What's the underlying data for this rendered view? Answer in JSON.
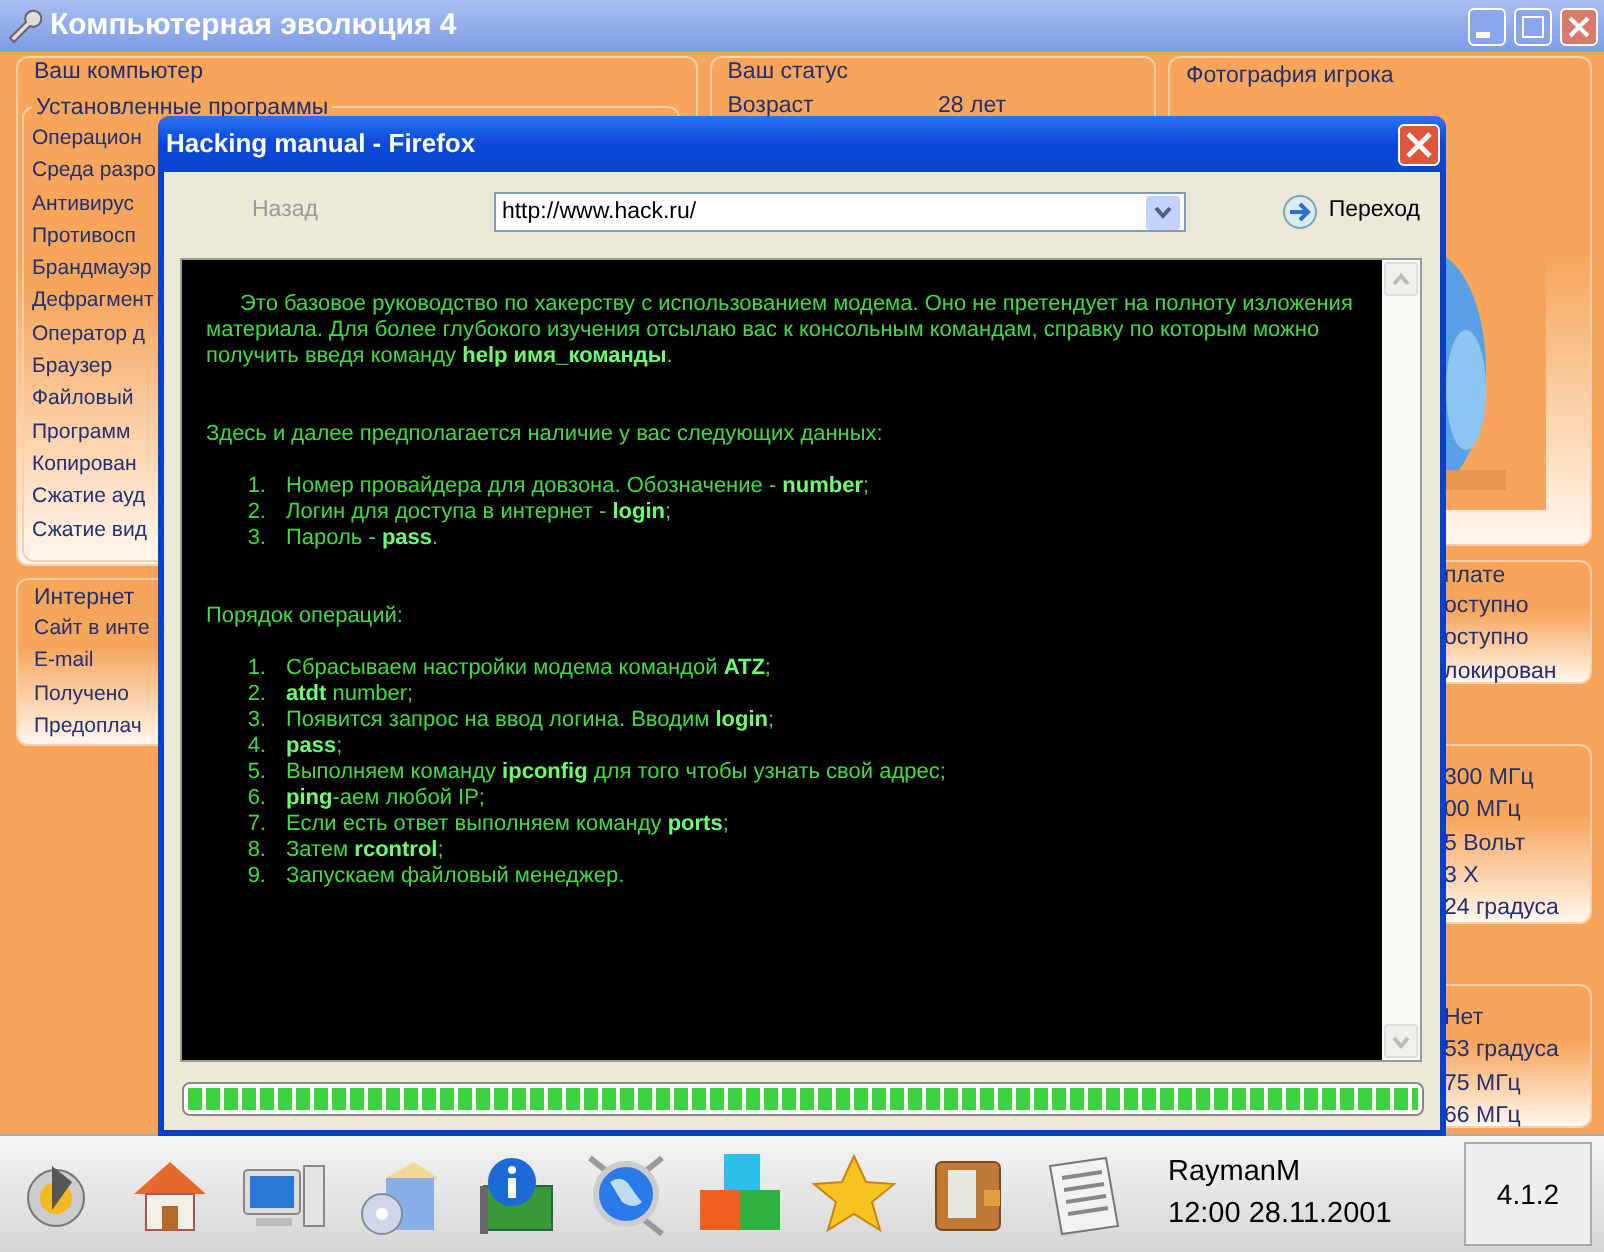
{
  "window": {
    "title": "Компьютерная эволюция 4"
  },
  "computer_panel": {
    "title": "Ваш компьютер",
    "group_title": "Установленные программы",
    "items": [
      "Операцион",
      "Среда разро",
      "Антивирус",
      "Противосп",
      "Брандмауэр",
      "Дефрагмент",
      "Оператор д",
      "Браузер",
      "Файловый",
      "Программ",
      "Копирован",
      "Сжатие ауд",
      "Сжатие вид"
    ]
  },
  "internet_panel": {
    "title": "Интернет",
    "items": [
      "Сайт в инте",
      "E-mail",
      "Получено",
      "Предоплач"
    ]
  },
  "status_panel": {
    "title": "Ваш статус",
    "rows": [
      {
        "label": "Возраст",
        "value": "28 лет"
      }
    ]
  },
  "photo_panel": {
    "title": "Фотография игрока"
  },
  "right_panels": [
    {
      "title": "плате",
      "values": [
        "оступно",
        "оступно",
        "локирован"
      ]
    },
    {
      "values": [
        "300 МГц",
        "00 МГц",
        "5 Вольт",
        "3 X",
        "24 градуса"
      ]
    },
    {
      "values": [
        "Нет",
        "53 градуса",
        "75 МГц",
        "66 МГц"
      ]
    }
  ],
  "dialog": {
    "title": "Hacking manual - Firefox",
    "back": {
      "label": "Назад",
      "disabled": true
    },
    "url": "http://www.hack.ru/",
    "go": {
      "label": "Переход"
    },
    "content": [
      {
        "kind": "intro",
        "text": "Это базовое руководство по хакерству с использованием модема. Оно не претендует на полноту изложения материала. Для более глубокого изучения отсылаю вас к консольным командам, справку по которым можно получить введя команду **help имя_команды**."
      },
      {
        "kind": "paragraph",
        "text": "Здесь и далее предполагается наличие у вас следующих данных:"
      },
      {
        "kind": "list",
        "items": [
          {
            "num": "1.",
            "text": "Номер провайдера для довзона. Обозначение - **number**;"
          },
          {
            "num": "2.",
            "text": "Логин для доступа в интернет - **login**;"
          },
          {
            "num": "3.",
            "text": "Пароль - **pass**."
          }
        ]
      },
      {
        "kind": "paragraph",
        "text": "Порядок операций:"
      },
      {
        "kind": "list",
        "items": [
          {
            "num": "1.",
            "text": "Сбрасываем настройки модема командой **ATZ**;"
          },
          {
            "num": "2.",
            "text": "**atdt** number;"
          },
          {
            "num": "3.",
            "text": "Появится запрос на ввод логина. Вводим **login**;"
          },
          {
            "num": "4.",
            "text": "**pass**;"
          },
          {
            "num": "5.",
            "text": "Выполняем команду **ipconfig** для того чтобы узнать свой адрес;"
          },
          {
            "num": "6.",
            "text": "**ping**-аем любой IP;"
          },
          {
            "num": "7.",
            "text": "Если есть ответ выполняем команду **ports**;"
          },
          {
            "num": "8.",
            "text": "Затем **rcontrol**;"
          },
          {
            "num": "9.",
            "text": "Запускаем файловый менеджер."
          }
        ]
      }
    ],
    "progress": {
      "level": 1
    }
  },
  "taskbar": {
    "user": "RaymanM",
    "datetime": "12:00 28.11.2001",
    "version": "4.1.2"
  }
}
